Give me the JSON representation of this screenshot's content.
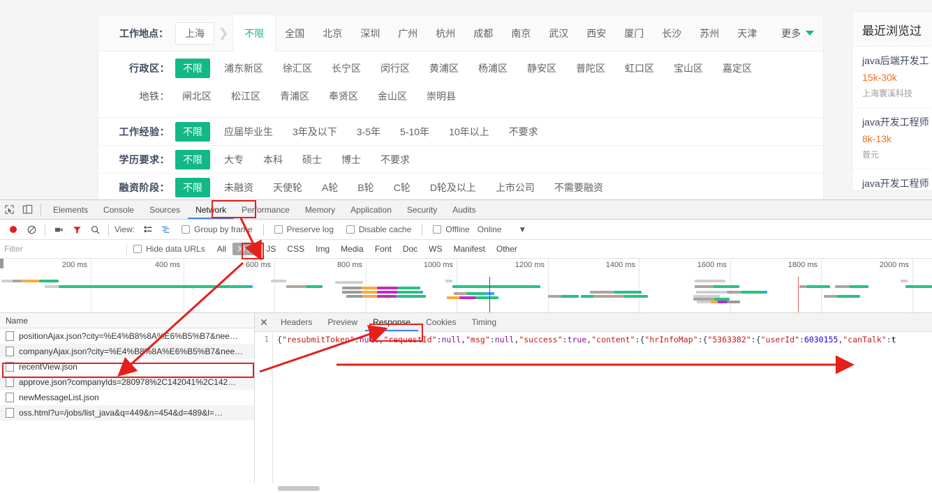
{
  "page": {
    "filters": {
      "city_row": {
        "label": "工作地点：",
        "selected_city": "上海",
        "active_tab": "不限",
        "cities": [
          "全国",
          "北京",
          "深圳",
          "广州",
          "杭州",
          "成都",
          "南京",
          "武汉",
          "西安",
          "厦门",
          "长沙",
          "苏州",
          "天津"
        ],
        "more_label": "更多"
      },
      "rows": [
        {
          "label": "行政区：",
          "bold": true,
          "selected": "不限",
          "items": [
            "浦东新区",
            "徐汇区",
            "长宁区",
            "闵行区",
            "黄浦区",
            "杨浦区",
            "静安区",
            "普陀区",
            "虹口区",
            "宝山区",
            "嘉定区"
          ]
        },
        {
          "label": "地铁：",
          "bold": false,
          "selected": null,
          "items": [
            "闸北区",
            "松江区",
            "青浦区",
            "奉贤区",
            "金山区",
            "崇明县"
          ]
        },
        {
          "label": "工作经验：",
          "bold": true,
          "selected": "不限",
          "items": [
            "应届毕业生",
            "3年及以下",
            "3-5年",
            "5-10年",
            "10年以上",
            "不要求"
          ]
        },
        {
          "label": "学历要求：",
          "bold": true,
          "selected": "不限",
          "items": [
            "大专",
            "本科",
            "硕士",
            "博士",
            "不要求"
          ]
        },
        {
          "label": "融资阶段：",
          "bold": true,
          "selected": "不限",
          "items": [
            "未融资",
            "天使轮",
            "A轮",
            "B轮",
            "C轮",
            "D轮及以上",
            "上市公司",
            "不需要融资"
          ]
        }
      ]
    },
    "rail": {
      "title": "最近浏览过",
      "items": [
        {
          "title": "java后端开发工",
          "salary": "15k-30k",
          "company": "上海寰溪科技"
        },
        {
          "title": "java开发工程师",
          "salary": "8k-13k",
          "company": "普元"
        },
        {
          "title": "java开发工程师",
          "salary": "",
          "company": ""
        }
      ]
    }
  },
  "devtools": {
    "icons": {
      "inspect": "inspect-element-icon",
      "device": "device-toolbar-icon"
    },
    "tabs": [
      "Elements",
      "Console",
      "Sources",
      "Network",
      "Performance",
      "Memory",
      "Application",
      "Security",
      "Audits"
    ],
    "active_tab": "Network",
    "toolbar": {
      "record_icon": "record-icon",
      "clear_icon": "clear-icon",
      "capture_screenshots_icon": "camera-icon",
      "filter_icon": "funnel-icon",
      "search_icon": "search-icon",
      "view_label": "View:",
      "view_list_icon": "list-view-icon",
      "view_waterfall_icon": "waterfall-view-icon",
      "group_by_frame": "Group by frame",
      "preserve_log": "Preserve log",
      "disable_cache": "Disable cache",
      "offline": "Offline",
      "online": "Online",
      "overflow_icon": "chevron-down-icon"
    },
    "filterbar": {
      "placeholder": "Filter",
      "value": "",
      "hide_data_urls": "Hide data URLs",
      "types": [
        "All",
        "XHR",
        "JS",
        "CSS",
        "Img",
        "Media",
        "Font",
        "Doc",
        "WS",
        "Manifest",
        "Other"
      ],
      "selected_type": "XHR"
    },
    "overview": {
      "ticks": [
        "200 ms",
        "400 ms",
        "600 ms",
        "800 ms",
        "1000 ms",
        "1200 ms",
        "1400 ms",
        "1600 ms",
        "1800 ms",
        "2000 ms"
      ]
    },
    "requests": {
      "column_header": "Name",
      "rows": [
        "positionAjax.json?city=%E4%B8%8A%E6%B5%B7&nee…",
        "companyAjax.json?city=%E4%B8%8A%E6%B5%B7&nee…",
        "recentView.json",
        "approve.json?companyIds=280978%2C142041%2C142…",
        "newMessageList.json",
        "oss.html?u=/jobs/list_java&q=449&n=454&d=489&l=…"
      ],
      "selected_index": 0
    },
    "detail": {
      "close_icon": "close-icon",
      "tabs": [
        "Headers",
        "Preview",
        "Response",
        "Cookies",
        "Timing"
      ],
      "active_tab": "Response",
      "line_number": "1",
      "response_body": "{\"resubmitToken\":null,\"requestId\":null,\"msg\":null,\"success\":true,\"content\":{\"hrInfoMap\":{\"5363382\":{\"userId\":6030155,\"canTalk\":t"
    }
  },
  "colors": {
    "brand_green": "#12b886",
    "annotation_red": "#e3201a",
    "salary_orange": "#f5711b",
    "tab_underline_blue": "#4387f0"
  }
}
